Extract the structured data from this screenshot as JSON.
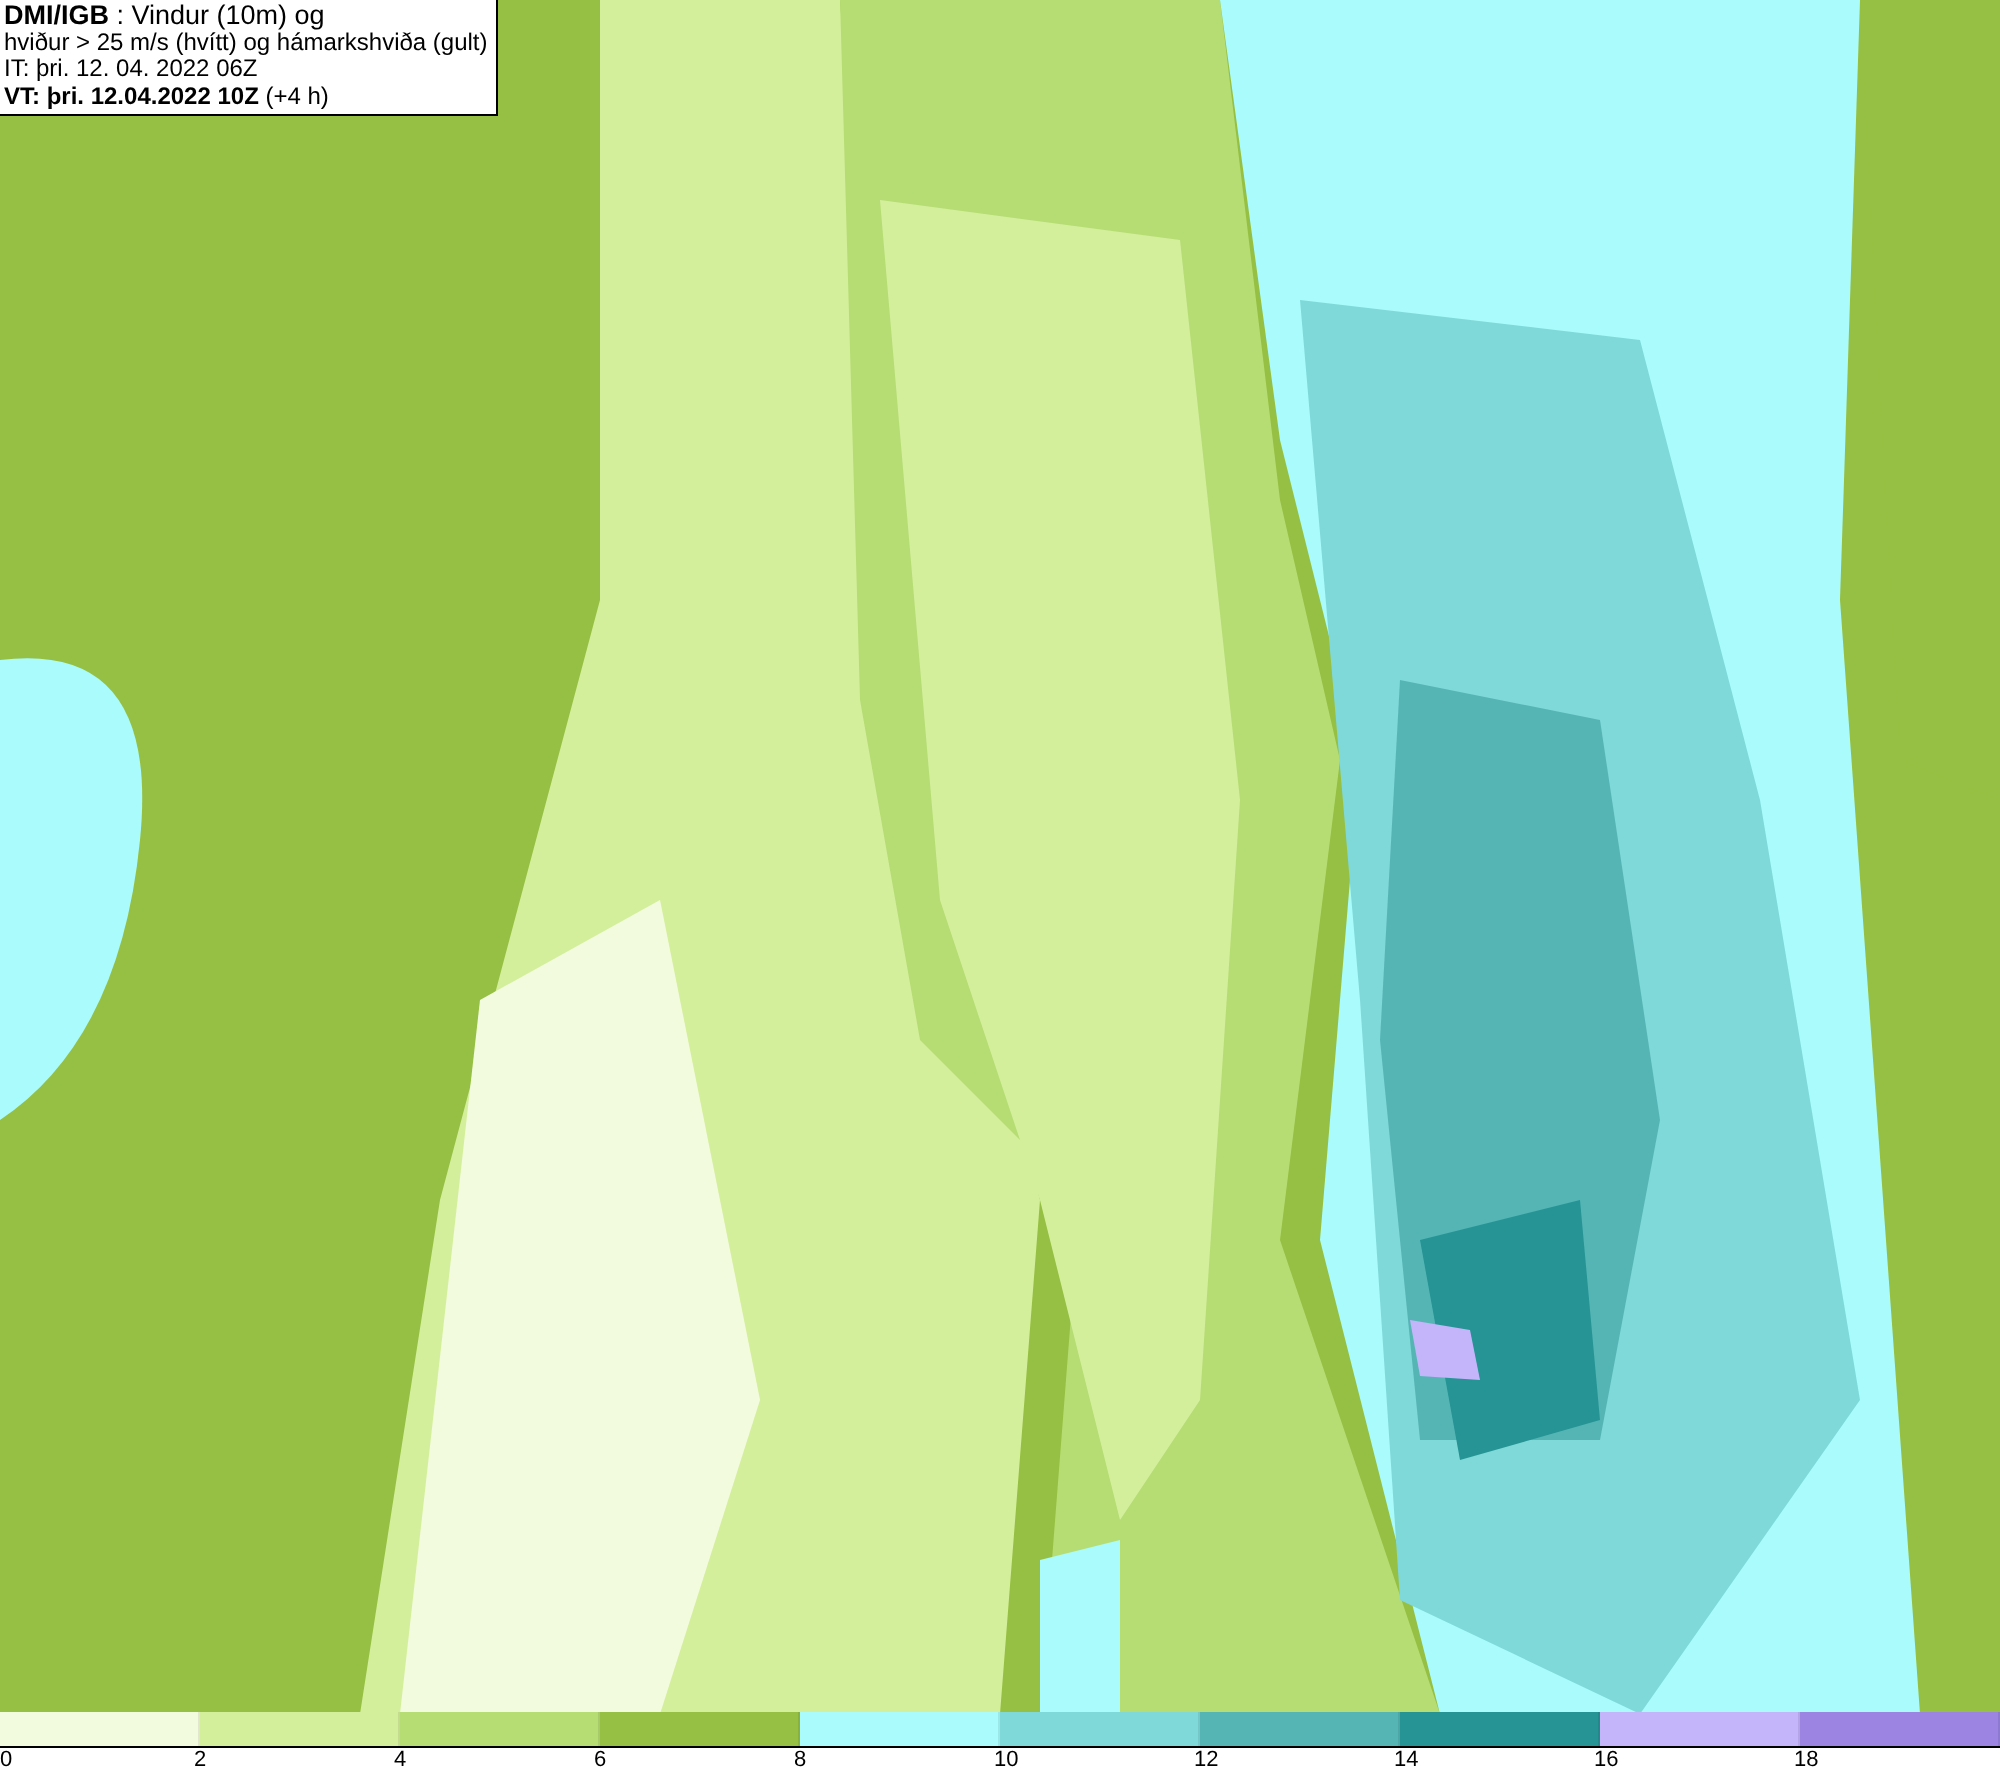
{
  "title_box": {
    "lines": [
      "**DMI/IGB** : Vindur (10m) og",
      "hviður > 25 m/s (hvítt) og hámarkshviða (gult)",
      "IT: þri. 12. 04. 2022 06Z",
      "**VT: þri. 12.04.2022 10Z** (+4 h)"
    ]
  },
  "legend": [
    {
      "label": "0",
      "color": "#f3fbdf"
    },
    {
      "label": "2",
      "color": "#d4ef9c"
    },
    {
      "label": "4",
      "color": "#b6dd74"
    },
    {
      "label": "6",
      "color": "#96c043"
    },
    {
      "label": "8",
      "color": "#aafcfc"
    },
    {
      "label": "10",
      "color": "#80d9d9"
    },
    {
      "label": "12",
      "color": "#55b5b5"
    },
    {
      "label": "14",
      "color": "#269494"
    },
    {
      "label": "16",
      "color": "#c4b4fa"
    },
    {
      "label": "18",
      "color": "#9b84e2"
    }
  ]
}
